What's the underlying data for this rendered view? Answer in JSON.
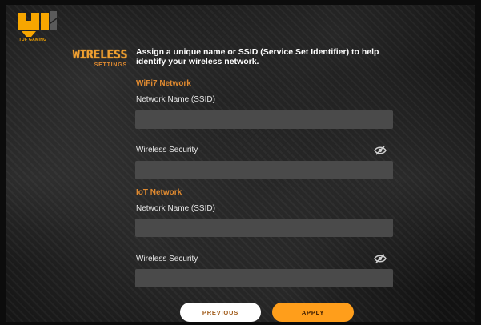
{
  "brand": {
    "logo_text": "TUF GAMING"
  },
  "header": {
    "section_title": "WIRELESS",
    "section_subtitle": "SETTINGS",
    "description": "Assign a unique name or SSID (Service Set Identifier) to help identify your wireless network."
  },
  "wifi7": {
    "title": "WiFi7 Network",
    "ssid_label": "Network Name (SSID)",
    "ssid_value": "",
    "security_label": "Wireless Security",
    "security_value": ""
  },
  "iot": {
    "title": "IoT Network",
    "ssid_label": "Network Name (SSID)",
    "ssid_value": "",
    "security_label": "Wireless Security",
    "security_value": ""
  },
  "actions": {
    "previous_label": "PREVIOUS",
    "apply_label": "APPLY"
  },
  "icons": {
    "password_toggle": "eye-slash-icon",
    "logo": "tuf-gaming-logo"
  },
  "colors": {
    "accent": "#ff9e1b",
    "field_bg": "#4a4a4a",
    "section_orange": "#e08a30"
  }
}
